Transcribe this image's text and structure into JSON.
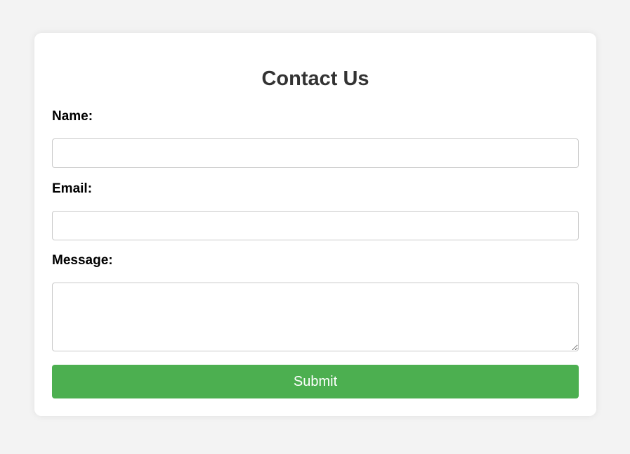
{
  "form": {
    "title": "Contact Us",
    "name_label": "Name:",
    "name_value": "",
    "email_label": "Email:",
    "email_value": "",
    "message_label": "Message:",
    "message_value": "",
    "submit_label": "Submit"
  },
  "colors": {
    "background": "#f3f3f3",
    "card": "#ffffff",
    "title_text": "#333333",
    "submit_button": "#4caf50",
    "field_border": "#c9c9c9"
  }
}
